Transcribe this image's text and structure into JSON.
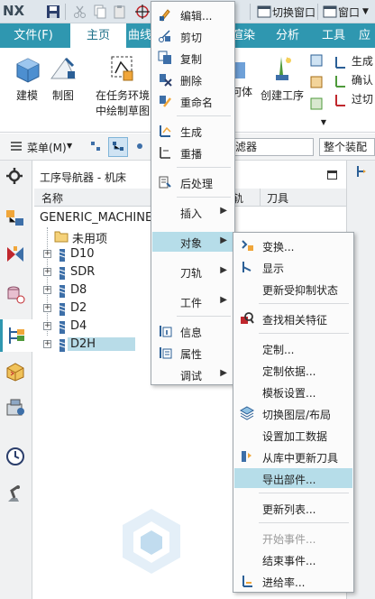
{
  "app": {
    "logo": "NX",
    "quick_access": [
      "save-icon",
      "cut-icon",
      "copy-icon",
      "paste-icon",
      "snap-icon"
    ],
    "switch_window": "切换窗口",
    "window_menu": "窗口"
  },
  "tabs": [
    {
      "label": "文件(F)"
    },
    {
      "label": "主页"
    },
    {
      "label": "曲线"
    },
    {
      "label": "渲染"
    },
    {
      "label": "分析"
    },
    {
      "label": "工具"
    },
    {
      "label": "应"
    }
  ],
  "ribbon": {
    "modeling": "建模",
    "drafting": "制图",
    "sketch_line1": "在任务环境",
    "sketch_line2": "中绘制草图",
    "geometry": "何体",
    "create_operation": "创建工序",
    "side1": "生成",
    "side2": "确认",
    "side3": "过切"
  },
  "cmdbar": {
    "menu_label": "菜单(M)",
    "filter_placeholder": "滤器",
    "assembly_filter": "整个装配"
  },
  "navigator": {
    "title": "工序导航器 - 机床",
    "col_name": "名称",
    "col_path": "轨",
    "col_tool": "刀具",
    "root": "GENERIC_MACHINE",
    "unused": "未用项",
    "tools": [
      "D10",
      "SDR",
      "D8",
      "D2",
      "D4",
      "D2H"
    ]
  },
  "context_menu": {
    "items": [
      {
        "label": "编辑...",
        "icon": "edit-icon"
      },
      {
        "label": "剪切",
        "icon": "cut-icon"
      },
      {
        "label": "复制",
        "icon": "copy-icon"
      },
      {
        "label": "删除",
        "icon": "delete-icon"
      },
      {
        "label": "重命名",
        "icon": "rename-icon"
      },
      {
        "label": "生成",
        "icon": "generate-icon"
      },
      {
        "label": "重播",
        "icon": "replay-icon"
      },
      {
        "label": "后处理",
        "icon": "postprocess-icon"
      },
      {
        "label": "插入",
        "icon": ""
      },
      {
        "label": "对象",
        "icon": ""
      },
      {
        "label": "刀轨",
        "icon": ""
      },
      {
        "label": "工件",
        "icon": ""
      },
      {
        "label": "信息",
        "icon": "info-icon"
      },
      {
        "label": "属性",
        "icon": "properties-icon"
      },
      {
        "label": "调试",
        "icon": ""
      }
    ]
  },
  "submenu": {
    "items": [
      {
        "label": "变换...",
        "icon": "transform-icon"
      },
      {
        "label": "显示",
        "icon": "display-icon"
      },
      {
        "label": "更新受抑制状态",
        "icon": ""
      },
      {
        "label": "查找相关特征",
        "icon": "find-feature-icon"
      },
      {
        "label": "定制...",
        "icon": ""
      },
      {
        "label": "定制依据...",
        "icon": ""
      },
      {
        "label": "模板设置...",
        "icon": ""
      },
      {
        "label": "切换图层/布局",
        "icon": "layer-icon"
      },
      {
        "label": "设置加工数据",
        "icon": ""
      },
      {
        "label": "从库中更新刀具",
        "icon": "library-update-icon"
      },
      {
        "label": "导出部件...",
        "icon": ""
      },
      {
        "label": "更新列表...",
        "icon": ""
      },
      {
        "label": "开始事件...",
        "icon": ""
      },
      {
        "label": "结束事件...",
        "icon": ""
      },
      {
        "label": "进给率...",
        "icon": "feedrate-icon"
      }
    ]
  },
  "colors": {
    "accent": "#2f97b0",
    "highlight": "#b6dde9",
    "selection": "#b8dce8"
  }
}
